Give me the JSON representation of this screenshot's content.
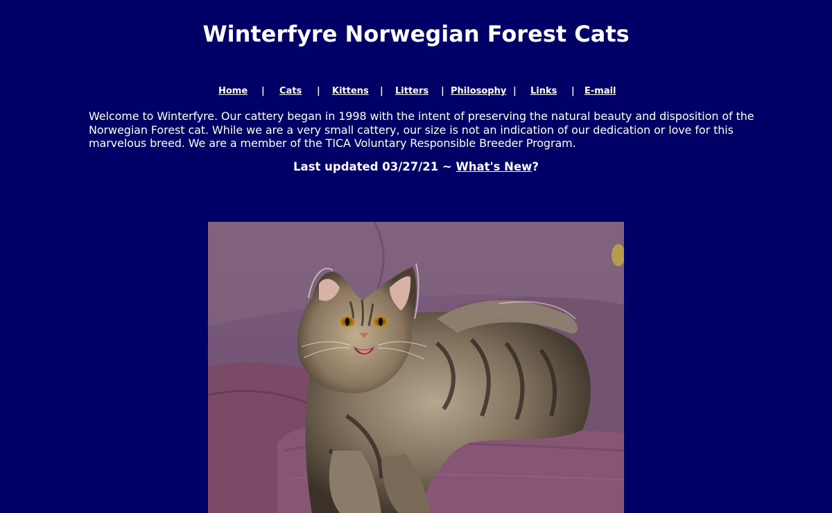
{
  "site": {
    "title": "Winterfyre Norwegian Forest Cats"
  },
  "nav": {
    "items": [
      {
        "label": "Home"
      },
      {
        "label": "Cats"
      },
      {
        "label": "Kittens"
      },
      {
        "label": "Litters"
      },
      {
        "label": "Philosophy"
      },
      {
        "label": "Links"
      },
      {
        "label": "E-mail"
      }
    ],
    "separator": "|"
  },
  "intro": {
    "text": "Welcome to Winterfyre. Our cattery began in 1998 with the intent of preserving the natural beauty and disposition of the Norwegian Forest cat. While we are a very small cattery, our size is not an indication of our dedication or love for this marvelous breed. We are a member of the TICA Voluntary Responsible Breeder Program."
  },
  "update": {
    "prefix": "Last updated 03/27/21 ~ ",
    "link_label": "What's New",
    "suffix": "?"
  },
  "colors": {
    "background": "#000066",
    "text": "#ffffff"
  }
}
